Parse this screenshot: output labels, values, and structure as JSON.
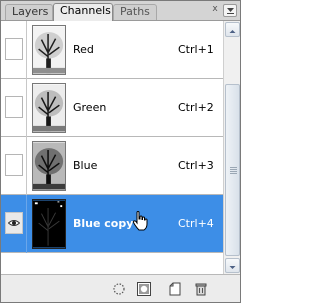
{
  "tabs": [
    {
      "label": "Layers"
    },
    {
      "label": "Channels"
    },
    {
      "label": "Paths"
    }
  ],
  "close_glyph": "x",
  "channels": [
    {
      "name": "Red",
      "shortcut": "Ctrl+1",
      "visible": false
    },
    {
      "name": "Green",
      "shortcut": "Ctrl+2",
      "visible": false
    },
    {
      "name": "Blue",
      "shortcut": "Ctrl+3",
      "visible": false
    },
    {
      "name": "Blue copy",
      "shortcut": "Ctrl+4",
      "visible": true,
      "selected": true
    }
  ],
  "colors": {
    "selection": "#3d8ee7",
    "panel_bg": "#ececec"
  },
  "bottom_icons": [
    "load-selection-icon",
    "save-selection-icon",
    "new-channel-icon",
    "delete-channel-icon"
  ]
}
